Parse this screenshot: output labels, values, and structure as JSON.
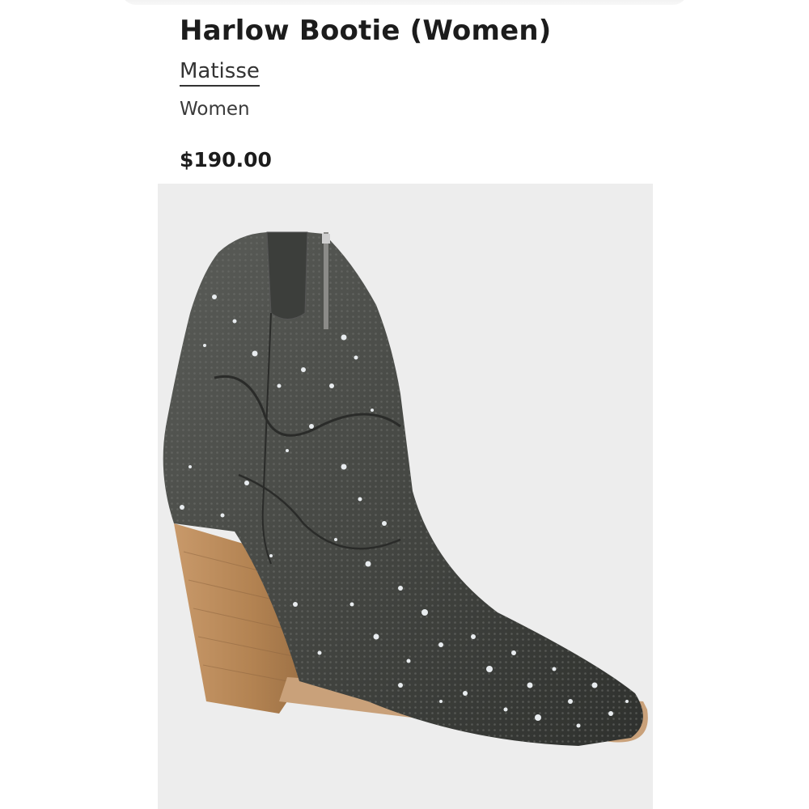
{
  "product": {
    "title": "Harlow Bootie (Women)",
    "brand": "Matisse",
    "department": "Women",
    "price": "$190.00"
  },
  "image": {
    "subject": "boot-image",
    "colors": {
      "background": "#ededed",
      "upper": "#4b4d4a",
      "upper_dark": "#2e302d",
      "heel": "#b98a5c",
      "sole": "#c9a17a",
      "sparkle": "#e8ecef"
    }
  }
}
